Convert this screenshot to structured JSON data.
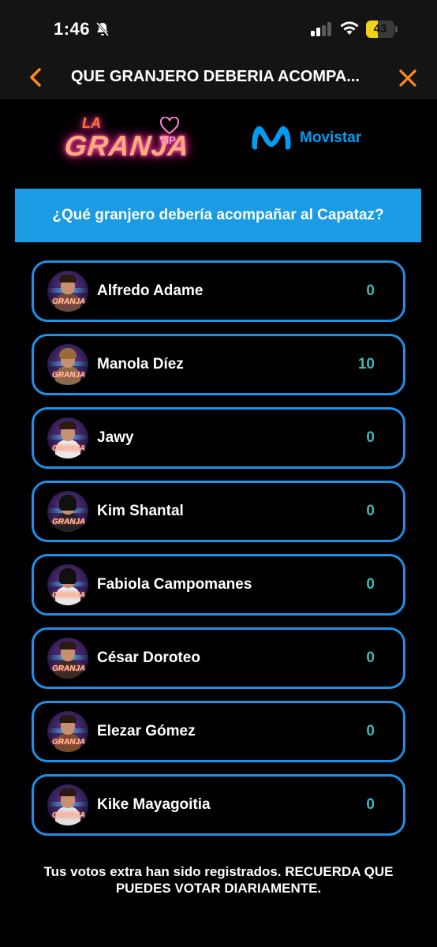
{
  "status_bar": {
    "time": "1:46",
    "battery": "43",
    "battery_fraction": 0.43,
    "icons": [
      "bell-slash-icon",
      "signal-icon",
      "wifi-icon",
      "battery-icon"
    ]
  },
  "nav": {
    "title": "QUE GRANJERO DEBERIA ACOMPA...",
    "back_icon": "chevron-left-icon",
    "close_icon": "close-icon",
    "accent_color": "#ff8a1f"
  },
  "logos": {
    "granja": {
      "la": "LA",
      "name": "GRANJA",
      "vip": "VIP"
    },
    "sponsor": "Movistar"
  },
  "question": "¿Qué granjero debería acompañar al Capataz?",
  "options": [
    {
      "name": "Alfredo Adame",
      "votes": "0"
    },
    {
      "name": "Manola Díez",
      "votes": "10"
    },
    {
      "name": "Jawy",
      "votes": "0"
    },
    {
      "name": "Kim Shantal",
      "votes": "0"
    },
    {
      "name": "Fabiola Campomanes",
      "votes": "0"
    },
    {
      "name": "César Doroteo",
      "votes": "0"
    },
    {
      "name": "Elezar Gómez",
      "votes": "0"
    },
    {
      "name": "Kike Mayagoitia",
      "votes": "0"
    }
  ],
  "footer": "Tus votos extra han sido registrados. RECUERDA QUE PUEDES VOTAR DIARIAMENTE.",
  "colors": {
    "banner": "#1a9be4",
    "option_border": "#1f8fe8",
    "votes": "#3fb7b7",
    "movistar": "#019df4"
  }
}
